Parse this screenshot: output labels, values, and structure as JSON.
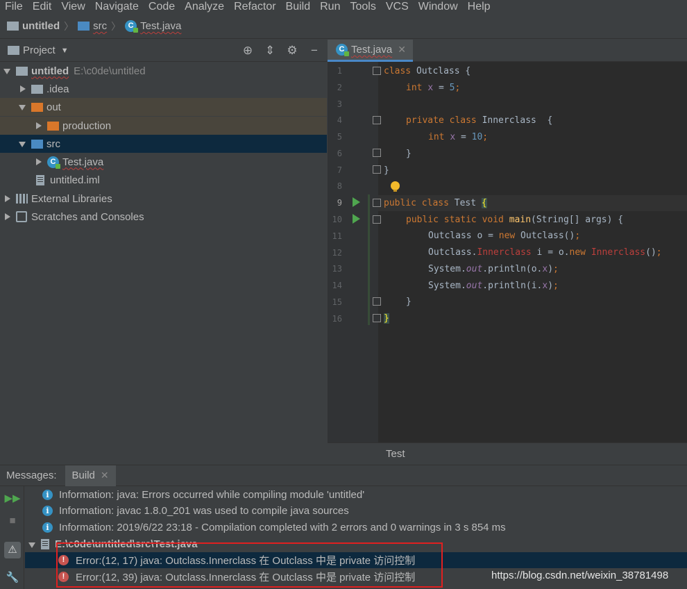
{
  "menu": [
    "File",
    "Edit",
    "View",
    "Navigate",
    "Code",
    "Analyze",
    "Refactor",
    "Build",
    "Run",
    "Tools",
    "VCS",
    "Window",
    "Help"
  ],
  "breadcrumb": [
    {
      "label": "untitled",
      "icon": "module-folder-icon"
    },
    {
      "label": "src",
      "icon": "source-folder-icon"
    },
    {
      "label": "Test.java",
      "icon": "java-class-icon"
    }
  ],
  "project_panel": {
    "title": "Project",
    "tools": [
      "locate-icon",
      "collapse-icon",
      "gear-icon",
      "minimize-icon"
    ],
    "tree": [
      {
        "label": "untitled",
        "path": "E:\\c0de\\untitled",
        "icon": "module-folder-icon",
        "expanded": true
      },
      {
        "label": ".idea",
        "icon": "folder-icon",
        "expanded": false
      },
      {
        "label": "out",
        "icon": "excluded-folder-icon",
        "expanded": true
      },
      {
        "label": "production",
        "icon": "excluded-folder-icon",
        "expanded": false
      },
      {
        "label": "src",
        "icon": "source-folder-icon",
        "expanded": true
      },
      {
        "label": "Test.java",
        "icon": "java-class-icon",
        "expanded": false
      },
      {
        "label": "untitled.iml",
        "icon": "iml-file-icon"
      },
      {
        "label": "External Libraries",
        "icon": "libraries-icon",
        "expanded": false
      },
      {
        "label": "Scratches and Consoles",
        "icon": "scratches-icon",
        "expanded": false
      }
    ]
  },
  "editor": {
    "tab": "Test.java",
    "line_numbers": [
      "1",
      "2",
      "3",
      "4",
      "5",
      "6",
      "7",
      "8",
      "9",
      "10",
      "11",
      "12",
      "13",
      "14",
      "15",
      "16"
    ],
    "current_line": 9,
    "footer": "Test",
    "code": {
      "l1_kw": "class",
      "l1_rest": " Outclass {",
      "l2_kw": "int",
      "l2_field": "x",
      "l2_eq": " = ",
      "l2_num": "5",
      "l2_semi": ";",
      "l4_kw": "private class",
      "l4_rest": " Innerclass  {",
      "l5_kw": "int",
      "l5_field": "x",
      "l5_eq": " = ",
      "l5_num": "10",
      "l5_semi": ";",
      "l6": "}",
      "l7": "}",
      "l9_kw": "public class",
      "l9_rest": " Test ",
      "l9_brace": "{",
      "l10_kw": "public static void",
      "l10_sp": " ",
      "l10_fn": "main",
      "l10_rest": "(String[] args) {",
      "l11_a": "Outclass o = ",
      "l11_kw": "new",
      "l11_b": " Outclass()",
      "l11_semi": ";",
      "l12_a": "Outclass.",
      "l12_err1": "Innerclass",
      "l12_b": " i = o.",
      "l12_kw": "new",
      "l12_sp": " ",
      "l12_err2": "Innerclass",
      "l12_c": "()",
      "l12_semi": ";",
      "l13_a": "System.",
      "l13_out": "out",
      "l13_b": ".println(o.",
      "l13_fld": "x",
      "l13_c": ")",
      "l13_semi": ";",
      "l14_a": "System.",
      "l14_out": "out",
      "l14_b": ".println(i.",
      "l14_fld": "x",
      "l14_c": ")",
      "l14_semi": ";",
      "l15": "}",
      "l16": "}"
    }
  },
  "messages": {
    "title": "Messages:",
    "tab": "Build",
    "rows": [
      {
        "type": "info",
        "text": "Information: java: Errors occurred while compiling module 'untitled'"
      },
      {
        "type": "info",
        "text": "Information: javac 1.8.0_201 was used to compile java sources"
      },
      {
        "type": "info",
        "text": "Information: 2019/6/22 23:18 - Compilation completed with 2 errors and 0 warnings in 3 s 854 ms"
      },
      {
        "type": "file",
        "text": "E:\\c0de\\untitled\\src\\Test.java"
      },
      {
        "type": "error",
        "text": "Error:(12, 17)  java: Outclass.Innerclass 在 Outclass 中是 private 访问控制"
      },
      {
        "type": "error",
        "text": "Error:(12, 39)  java: Outclass.Innerclass 在 Outclass 中是 private 访问控制"
      }
    ]
  },
  "watermark": "https://blog.csdn.net/weixin_38781498",
  "colors": {
    "accent": "#4a88c7",
    "error": "#c75450",
    "highlight_box": "#e02020",
    "selection": "#0d293e"
  }
}
